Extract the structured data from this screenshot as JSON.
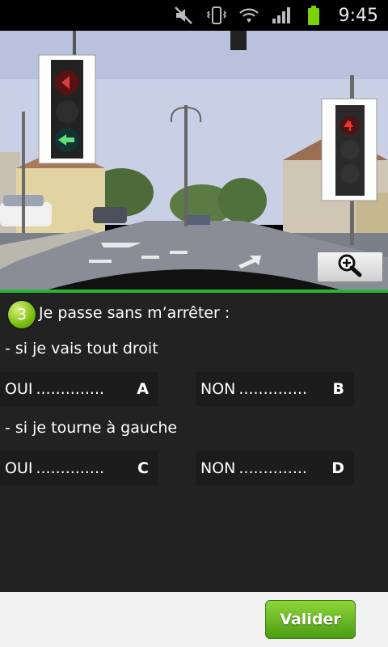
{
  "status_bar": {
    "time": "9:45",
    "icons": [
      "mute-icon",
      "vibrate-icon",
      "wifi-icon",
      "signal-icon",
      "battery-icon"
    ]
  },
  "image": {
    "description_icon": "zoom-in-icon"
  },
  "question": {
    "number": "3",
    "text": "Je passe sans m’arrêter :",
    "sub_questions": [
      {
        "label": "- si je vais tout droit",
        "answers": [
          {
            "word": "OUI",
            "dots": "..............",
            "letter": "A"
          },
          {
            "word": "NON",
            "dots": "..............",
            "letter": "B"
          }
        ]
      },
      {
        "label": "- si je tourne à gauche",
        "answers": [
          {
            "word": "OUI",
            "dots": "..............",
            "letter": "C"
          },
          {
            "word": "NON",
            "dots": "..............",
            "letter": "D"
          }
        ]
      }
    ]
  },
  "footer": {
    "validate_label": "Valider"
  },
  "colors": {
    "accent_green": "#26b635",
    "panel_bg": "#222222",
    "button_green": "#6ab827"
  }
}
